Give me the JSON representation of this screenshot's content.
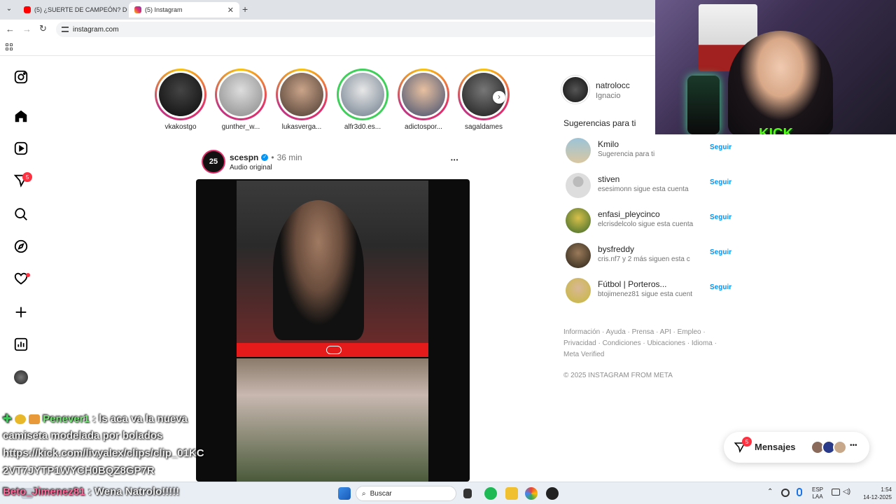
{
  "browser": {
    "tabs": [
      {
        "title": "(5) ¿SUERTE DE CAMPEÓN? DO",
        "color": "#ff0000"
      },
      {
        "title": "(5) Instagram",
        "color": "#e1306c"
      }
    ],
    "url": "instagram.com"
  },
  "nav": {
    "notification_badge": "5"
  },
  "stories": [
    {
      "name": "vkakostgo",
      "close_friend": false
    },
    {
      "name": "gunther_w...",
      "close_friend": false
    },
    {
      "name": "lukasverga...",
      "close_friend": false
    },
    {
      "name": "alfr3d0.es...",
      "close_friend": true
    },
    {
      "name": "adictospor...",
      "close_friend": false
    },
    {
      "name": "sagaldames",
      "close_friend": false
    }
  ],
  "post": {
    "avatar_text": "25",
    "username": "scespn",
    "time": "36 min",
    "separator": "•",
    "audio": "Audio original",
    "more": "•••"
  },
  "profile": {
    "username": "natrolocc",
    "full_name": "Ignacio"
  },
  "suggestions": {
    "title": "Sugerencias para ti",
    "items": [
      {
        "name": "Kmilo",
        "sub": "Sugerencia para ti",
        "follow": "Seguir"
      },
      {
        "name": "stiven",
        "sub": "esesimonn sigue esta cuenta",
        "follow": "Seguir"
      },
      {
        "name": "enfasi_pleycinco",
        "sub": "elcrisdelcolo sigue esta cuenta",
        "follow": "Seguir"
      },
      {
        "name": "bysfreddy",
        "sub": "cris.nf7 y 2 más siguen esta c",
        "follow": "Seguir"
      },
      {
        "name": "Fútbol | Porteros...",
        "sub": "btojimenez81 sigue esta cuent",
        "follow": "Seguir"
      }
    ]
  },
  "footer": {
    "line1": "Información · Ayuda · Prensa · API · Empleo ·",
    "line2": "Privacidad · Condiciones · Ubicaciones · Idioma ·",
    "line3": "Meta Verified",
    "copyright": "© 2025 INSTAGRAM FROM META"
  },
  "messages": {
    "label": "Mensajes",
    "badge": "5"
  },
  "stream": {
    "kick_logo": "KICK",
    "kick_user": "natrolocc",
    "chat": [
      {
        "user": "Penever1",
        "text": ": ls aca va la nueva"
      },
      {
        "text": "camiseta modelada por bolados"
      },
      {
        "text": "https://kick.com/livyalex/clips/clip_01KC"
      },
      {
        "text": "2VT7JYTP1WYCH0BQZ8GP7R"
      },
      {
        "user": "Beto_Jimenez81",
        "text": ": Wena Natrolo!!!!!"
      }
    ]
  },
  "taskbar": {
    "search": "Buscar",
    "lang": "ESP",
    "lang2": "LAA",
    "time": "1:54",
    "date": "14-12-2025"
  }
}
